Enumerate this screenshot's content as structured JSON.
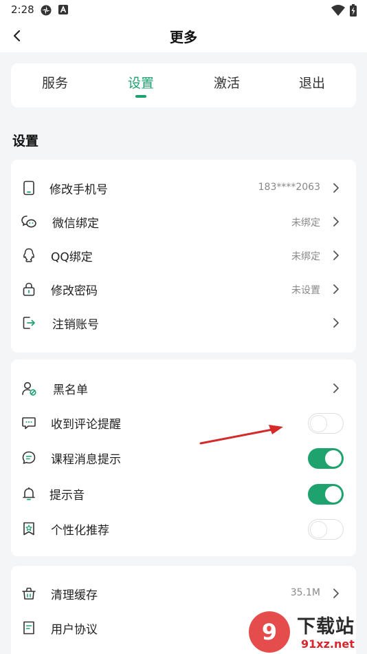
{
  "status_bar": {
    "time": "2:28"
  },
  "header": {
    "title": "更多"
  },
  "tabs": [
    {
      "label": "服务",
      "active": false
    },
    {
      "label": "设置",
      "active": true
    },
    {
      "label": "激活",
      "active": false
    },
    {
      "label": "退出",
      "active": false
    }
  ],
  "section_title": "设置",
  "account_card": {
    "items": [
      {
        "label": "修改手机号",
        "value": "183****2063",
        "icon": "phone-icon"
      },
      {
        "label": "微信绑定",
        "value": "未绑定",
        "icon": "wechat-icon"
      },
      {
        "label": "QQ绑定",
        "value": "未绑定",
        "icon": "qq-icon"
      },
      {
        "label": "修改密码",
        "value": "未设置",
        "icon": "lock-icon"
      },
      {
        "label": "注销账号",
        "value": "",
        "icon": "logout-icon"
      }
    ]
  },
  "notify_card": {
    "items": [
      {
        "label": "黑名单",
        "type": "link",
        "icon": "blacklist-user-icon"
      },
      {
        "label": "收到评论提醒",
        "type": "toggle",
        "on": false,
        "icon": "comment-icon"
      },
      {
        "label": "课程消息提示",
        "type": "toggle",
        "on": true,
        "icon": "message-icon"
      },
      {
        "label": "提示音",
        "type": "toggle",
        "on": true,
        "icon": "bell-icon"
      },
      {
        "label": "个性化推荐",
        "type": "toggle",
        "on": false,
        "icon": "bookmark-star-icon"
      }
    ]
  },
  "other_card": {
    "items": [
      {
        "label": "清理缓存",
        "value": "35.1M",
        "icon": "trash-icon"
      },
      {
        "label": "用户协议",
        "value": "",
        "icon": "document-icon"
      }
    ]
  },
  "watermark": {
    "brand": "下载站",
    "site": "91xz.net"
  },
  "colors": {
    "accent": "#1ea36e",
    "arrow": "#d42a2a"
  }
}
